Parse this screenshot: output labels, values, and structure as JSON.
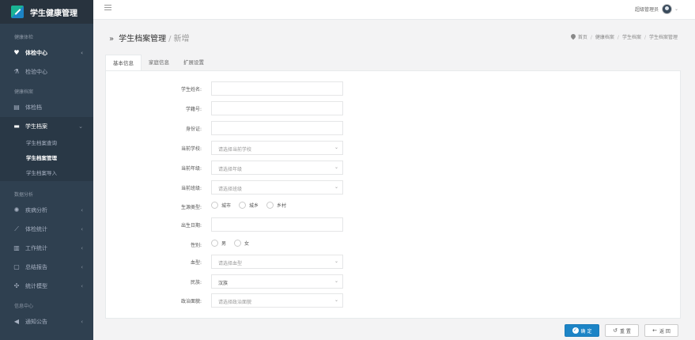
{
  "app": {
    "title": "学生健康管理"
  },
  "sidebar": {
    "sections": [
      {
        "title": "健康体检",
        "items": [
          {
            "label": "体检中心",
            "icon": "heart-icon",
            "bold": true
          },
          {
            "label": "检验中心",
            "icon": "flask-icon"
          }
        ]
      },
      {
        "title": "健康档案",
        "items": [
          {
            "label": "体检档",
            "icon": "document-icon"
          },
          {
            "label": "学生档案",
            "icon": "folder-icon",
            "open": true,
            "sub": [
              {
                "label": "学生档案查询"
              },
              {
                "label": "学生档案管理",
                "active": true
              },
              {
                "label": "学生档案导入"
              }
            ]
          }
        ]
      },
      {
        "title": "数据分析",
        "items": [
          {
            "label": "疾病分析",
            "icon": "virus-icon"
          },
          {
            "label": "体检统计",
            "icon": "line-chart-icon"
          },
          {
            "label": "工作统计",
            "icon": "bar-chart-icon"
          },
          {
            "label": "总结报告",
            "icon": "report-icon"
          },
          {
            "label": "统计模型",
            "icon": "model-icon"
          }
        ]
      },
      {
        "title": "信息中心",
        "items": [
          {
            "label": "通知公告",
            "icon": "megaphone-icon"
          }
        ]
      }
    ]
  },
  "topbar": {
    "user_name": "超级管理员"
  },
  "page": {
    "title_main": "学生档案管理",
    "title_sep": "/",
    "title_sub": "新增",
    "breadcrumb": [
      "首页",
      "健康档案",
      "学生档案",
      "学生档案管理"
    ]
  },
  "tabs": [
    {
      "label": "基本信息",
      "active": true
    },
    {
      "label": "家庭信息"
    },
    {
      "label": "扩展设置"
    }
  ],
  "form": {
    "student_name": {
      "label": "学生姓名:",
      "value": ""
    },
    "student_id": {
      "label": "学籍号:",
      "value": ""
    },
    "id_card": {
      "label": "身份证:",
      "value": ""
    },
    "school": {
      "label": "当前学校:",
      "placeholder": "请选择当前学校"
    },
    "grade": {
      "label": "当前年级:",
      "placeholder": "请选择年级"
    },
    "class": {
      "label": "当前班级:",
      "placeholder": "请选择班级"
    },
    "origin": {
      "label": "生源类型:",
      "options": [
        "城市",
        "城乡",
        "乡村"
      ]
    },
    "birthdate": {
      "label": "出生日期:",
      "value": ""
    },
    "gender": {
      "label": "性别:",
      "options": [
        "男",
        "女"
      ]
    },
    "blood_type": {
      "label": "血型:",
      "placeholder": "请选择血型"
    },
    "ethnicity": {
      "label": "民族:",
      "value": "汉族"
    },
    "politics": {
      "label": "政治面貌:",
      "placeholder": "请选择政治面貌"
    }
  },
  "buttons": {
    "ok": "确 定",
    "reset": "重 置",
    "back": "返 回"
  }
}
